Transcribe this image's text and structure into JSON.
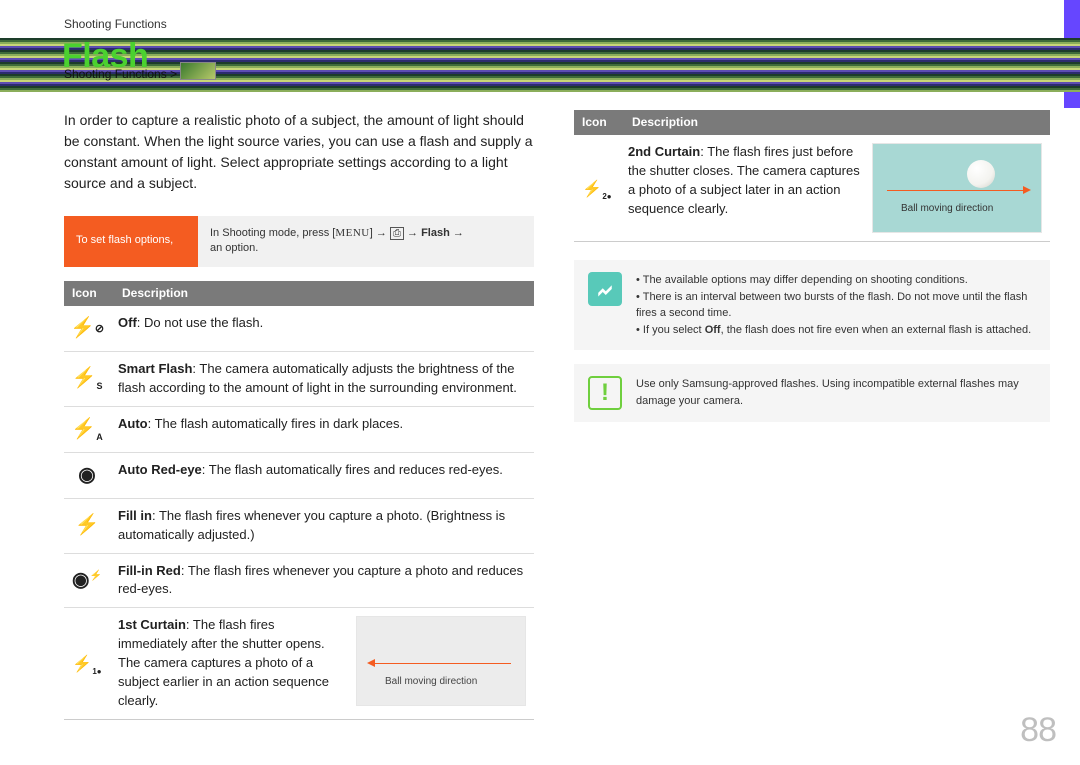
{
  "page": {
    "breadcrumb_top": "Shooting Functions",
    "title": "Flash",
    "breadcrumb_sub": "Shooting Functions >",
    "number": "88"
  },
  "intro": "In order to capture a realistic photo of a subject, the amount of light should be constant. When the light source varies, you can use a flash and supply a constant amount of light. Select appropriate settings according to a light source and a subject.",
  "setbox": {
    "label": "To set flash options,",
    "text_prefix": "In Shooting mode, press [",
    "menu": "MENU",
    "arrow": "→",
    "cam_icon": "⎙",
    "flash_word": "Flash",
    "text_suffix": "an option."
  },
  "table_headers": {
    "icon": "Icon",
    "desc": "Description"
  },
  "rows_left": [
    {
      "icon": "off",
      "bold": "Off",
      "text": ": Do not use the flash."
    },
    {
      "icon": "smart",
      "bold": "Smart Flash",
      "text": ": The camera automatically adjusts the brightness of the flash according to the amount of light in the surrounding environment."
    },
    {
      "icon": "auto",
      "bold": "Auto",
      "text": ": The flash automatically fires in dark places."
    },
    {
      "icon": "redeye",
      "bold": "Auto Red-eye",
      "text": ": The flash automatically fires and reduces red-eyes."
    },
    {
      "icon": "fillin",
      "bold": "Fill in",
      "text": ": The flash fires whenever you capture a photo. (Brightness is automatically adjusted.)"
    },
    {
      "icon": "fillred",
      "bold": "Fill-in Red",
      "text": ": The flash fires whenever you capture a photo and reduces red-eyes."
    }
  ],
  "curtain1": {
    "bold": "1st Curtain",
    "text": ": The flash fires immediately after the shutter opens. The camera captures a photo of a subject earlier in an action sequence clearly.",
    "caption": "Ball moving direction"
  },
  "curtain2": {
    "bold": "2nd Curtain",
    "text": ": The flash fires just before the shutter closes. The camera captures a photo of a subject later in an action sequence clearly.",
    "caption": "Ball moving direction"
  },
  "note_info": {
    "lines": [
      "The available options may differ depending on shooting conditions.",
      "There is an interval between two bursts of the flash. Do not move until the flash fires a second time.",
      "If you select Off, the flash does not fire even when an external flash is attached."
    ]
  },
  "note_warn": "Use only Samsung-approved flashes. Using incompatible external flashes may damage your camera."
}
